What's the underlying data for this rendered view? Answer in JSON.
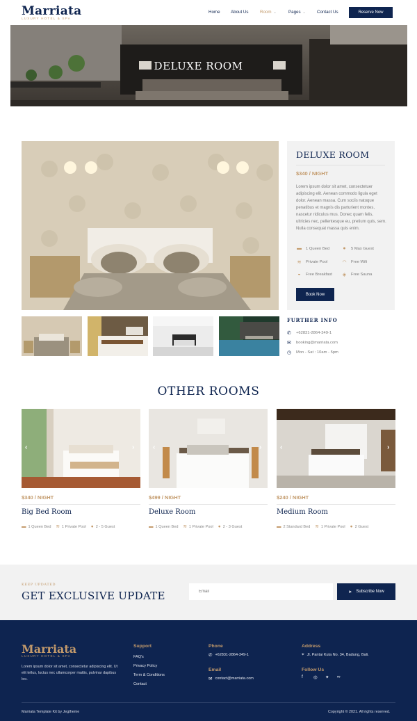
{
  "header": {
    "logo": "Marriata",
    "logo_sub": "LUXURY HOTEL & SPA",
    "nav": [
      {
        "label": "Home"
      },
      {
        "label": "About Us"
      },
      {
        "label": "Room"
      },
      {
        "label": "Pages"
      },
      {
        "label": "Contact Us"
      }
    ],
    "reserve": "Reserve Now",
    "accent": "#c39a6b",
    "navy": "#0f2550"
  },
  "hero": {
    "title": "DELUXE ROOM"
  },
  "room": {
    "title": "DELUXE ROOM",
    "price": "$340 / NIGHT",
    "description": "Lorem ipsum dolor sit amet, consectetuer adipiscing elit. Aenean commodo ligula eget dolor. Aenean massa. Cum sociis natoque penatibus et magnis dis parturient montes, nascetur ridiculus mus. Donec quam felis, ultricies nec, pellentesque eu, pretium quis, sem. Nulla consequat massa quis enim.",
    "amenities": [
      {
        "label": "1 Queen Bed",
        "icon": "bed-icon"
      },
      {
        "label": "5 Max Guest",
        "icon": "guests-icon"
      },
      {
        "label": "Private Pool",
        "icon": "pool-icon"
      },
      {
        "label": "Free Wifi",
        "icon": "wifi-icon"
      },
      {
        "label": "Free Breakfast",
        "icon": "breakfast-icon"
      },
      {
        "label": "Free Sauna",
        "icon": "sauna-icon"
      }
    ],
    "book": "Book Now"
  },
  "further_info": {
    "title": "FURTHER INFO",
    "phone": "+62831-2864-349-1",
    "email": "booking@marriata.com",
    "hours": "Mon - Sat : 10am - 5pm"
  },
  "other_rooms": {
    "title": "OTHER ROOMS",
    "rooms": [
      {
        "price": "$340 / NIGHT",
        "name": "Big Bed Room",
        "f1": "1 Queen Bed",
        "f2": "1 Private Pool",
        "f3": "2 - 5 Guest"
      },
      {
        "price": "$499 / NIGHT",
        "name": "Deluxe Room",
        "f1": "1 Queen Bed",
        "f2": "1 Private Pool",
        "f3": "2 - 3 Guest"
      },
      {
        "price": "$240 / NIGHT",
        "name": "Medium Room",
        "f1": "2 Standard Bed",
        "f2": "1 Private Pool",
        "f3": "2 Guest"
      }
    ]
  },
  "subscribe": {
    "kicker": "KEEP UPDATED",
    "title": "GET EXCLUSIVE UPDATE",
    "placeholder": "Email",
    "button": "Subscribe Now"
  },
  "footer": {
    "logo": "Marriata",
    "logo_sub": "LUXURY HOTEL & SPA",
    "desc": "Lorem ipsum dolor sit amet, consectetur adipiscing elit. Ut elit tellus, luctus nec ullamcorper mattis, pulvinar dapibus leo.",
    "support_title": "Support",
    "support_links": [
      "FAQ's",
      "Privacy Policy",
      "Term & Conditions",
      "Contact"
    ],
    "phone_title": "Phone",
    "phone": "+62831-2864-349-1",
    "email_title": "Email",
    "email": "contact@marriata.com",
    "address_title": "Address",
    "address": "Jl. Pantai Kuta No. 34, Badung, Bali.",
    "follow_title": "Follow Us",
    "credit": "Marriata Template Kit by Jegtheme",
    "copyright": "Copyright © 2021. All rights reserved."
  }
}
